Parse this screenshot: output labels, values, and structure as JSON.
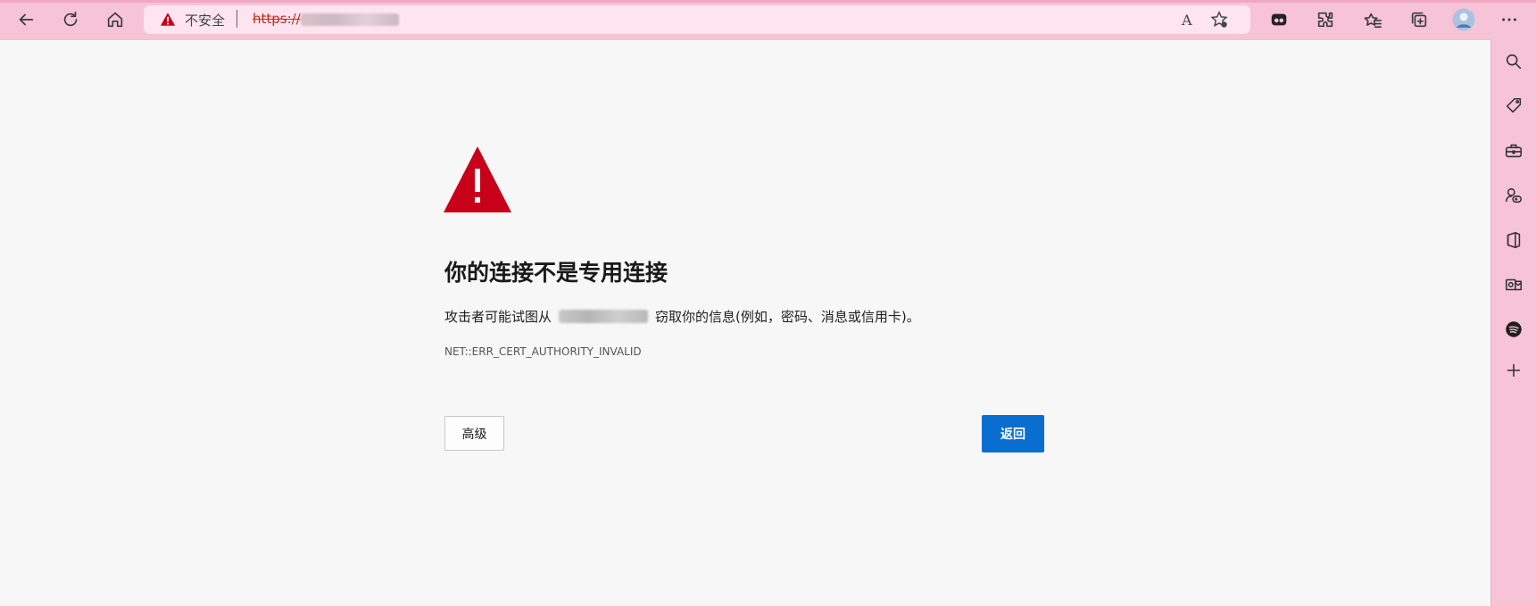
{
  "browser": {
    "address_bar": {
      "security_label": "不安全",
      "url_prefix": "https://",
      "read_aloud": "A"
    },
    "toolbar_icons": [
      "back-icon",
      "refresh-icon",
      "home-icon",
      "read-aloud-icon",
      "add-favorite-icon",
      "tab-actions-icon",
      "extensions-icon",
      "favorites-icon",
      "collections-icon",
      "profile-avatar",
      "more-icon"
    ],
    "sidebar_icons": [
      "search-icon",
      "shopping-tag-icon",
      "tools-icon",
      "games-icon",
      "office-icon",
      "outlook-icon",
      "spotify-icon",
      "add-icon"
    ]
  },
  "error_page": {
    "heading": "你的连接不是专用连接",
    "description_prefix": "攻击者可能试图从",
    "description_suffix": "窃取你的信息(例如，密码、消息或信用卡)。",
    "error_code": "NET::ERR_CERT_AUTHORITY_INVALID",
    "advanced_button": "高级",
    "back_button": "返回"
  },
  "colors": {
    "theme_pink": "#f7c3d6",
    "warning_red": "#c8001a",
    "primary_blue": "#0a6ed1",
    "page_bg": "#f7f7f7"
  }
}
